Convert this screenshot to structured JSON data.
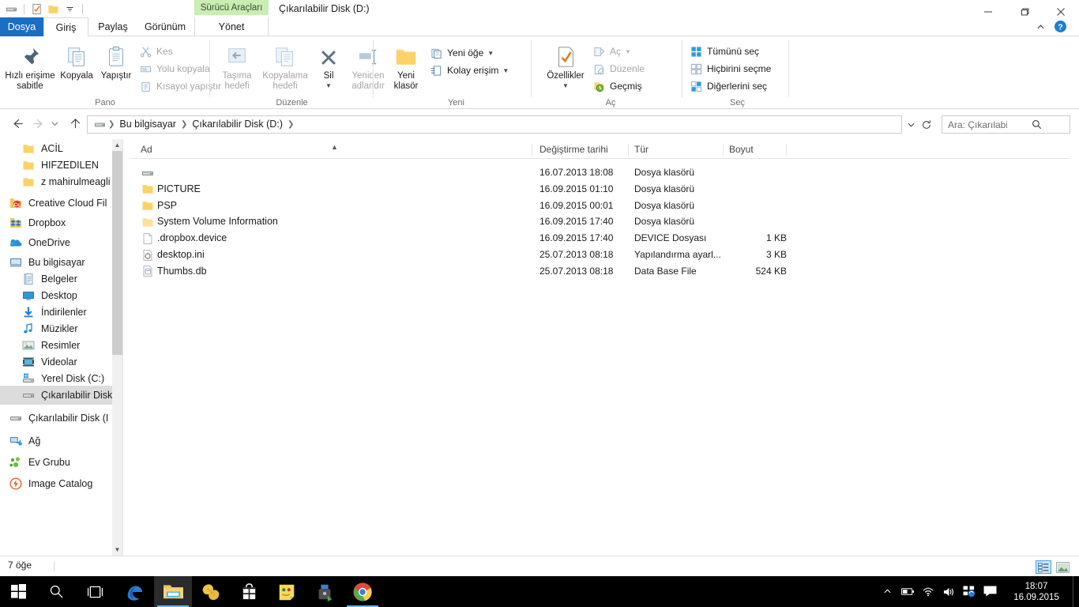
{
  "window": {
    "title": "Çıkarılabilir Disk (D:)",
    "contextual_tab": "Sürücü Araçları",
    "minimize": "minimize-button",
    "maximize": "maximize-button",
    "close": "close-button"
  },
  "quick_access": {
    "items": [
      "removable-drive-icon",
      "properties-icon",
      "new-folder-icon",
      "customize-dropdown-icon"
    ]
  },
  "tabs": [
    {
      "label": "Dosya",
      "kind": "file"
    },
    {
      "label": "Giriş",
      "kind": "active"
    },
    {
      "label": "Paylaş",
      "kind": "normal"
    },
    {
      "label": "Görünüm",
      "kind": "normal"
    },
    {
      "label": "Yönet",
      "kind": "manage"
    }
  ],
  "ribbon": {
    "collapse_label": "ribbon-collapse-icon",
    "help_label": "help-icon",
    "groups": [
      {
        "name": "Pano",
        "big": [
          {
            "label": "Hızlı erişime sabitle",
            "icon": "pin-icon"
          },
          {
            "label": "Kopyala",
            "icon": "copy-icon"
          },
          {
            "label": "Yapıştır",
            "icon": "paste-icon"
          }
        ],
        "small": [
          {
            "label": "Kes",
            "icon": "scissors-icon",
            "disabled": true
          },
          {
            "label": "Yolu kopyala",
            "icon": "copy-path-icon",
            "disabled": true
          },
          {
            "label": "Kısayol yapıştır",
            "icon": "paste-shortcut-icon",
            "disabled": true
          }
        ]
      },
      {
        "name": "Düzenle",
        "big": [
          {
            "label": "Taşıma hedefi",
            "icon": "move-to-icon",
            "dropdown": true,
            "disabled": true
          },
          {
            "label": "Kopyalama hedefi",
            "icon": "copy-to-icon",
            "dropdown": true,
            "disabled": true
          },
          {
            "label": "Sil",
            "icon": "delete-icon",
            "dropdown": true
          },
          {
            "label": "Yeniden adlandır",
            "icon": "rename-icon",
            "disabled": true
          }
        ]
      },
      {
        "name": "Yeni",
        "big": [
          {
            "label": "Yeni klasör",
            "icon": "new-folder-icon"
          }
        ],
        "small": [
          {
            "label": "Yeni öğe",
            "icon": "new-item-icon",
            "dropdown": true
          },
          {
            "label": "Kolay erişim",
            "icon": "easy-access-icon",
            "dropdown": true
          }
        ]
      },
      {
        "name": "Aç",
        "big": [
          {
            "label": "Özellikler",
            "icon": "properties-icon",
            "dropdown": true
          }
        ],
        "small": [
          {
            "label": "Aç",
            "icon": "open-icon",
            "dropdown": true,
            "disabled": true
          },
          {
            "label": "Düzenle",
            "icon": "edit-icon",
            "disabled": true
          },
          {
            "label": "Geçmiş",
            "icon": "history-icon"
          }
        ]
      },
      {
        "name": "Seç",
        "small": [
          {
            "label": "Tümünü seç",
            "icon": "select-all-icon"
          },
          {
            "label": "Hiçbirini seçme",
            "icon": "select-none-icon"
          },
          {
            "label": "Diğerlerini seç",
            "icon": "invert-selection-icon"
          }
        ]
      }
    ]
  },
  "navigation": {
    "back": "back-icon",
    "forward": "forward-icon",
    "recent": "recent-locations-icon",
    "up": "up-icon",
    "breadcrumb": [
      "Bu bilgisayar",
      "Çıkarılabilir Disk (D:)"
    ],
    "breadcrumb_icon": "removable-drive-icon",
    "refresh": "refresh-icon",
    "dropdown": "address-dropdown-icon"
  },
  "search": {
    "placeholder": "Ara: Çıkarılabilir Disk (...",
    "value": "",
    "icon": "search-icon"
  },
  "sidebar": {
    "items": [
      {
        "label": "ACİL",
        "icon": "folder-icon",
        "indent": 2
      },
      {
        "label": "HIFZEDILEN",
        "icon": "folder-icon",
        "indent": 2
      },
      {
        "label": "z mahirulmeagli",
        "icon": "folder-icon",
        "indent": 2
      },
      {
        "label": "Creative Cloud Fil",
        "icon": "creative-cloud-icon",
        "indent": 1
      },
      {
        "label": "Dropbox",
        "icon": "dropbox-icon",
        "indent": 1
      },
      {
        "label": "OneDrive",
        "icon": "onedrive-icon",
        "indent": 1
      },
      {
        "label": "Bu bilgisayar",
        "icon": "computer-icon",
        "indent": 1
      },
      {
        "label": "Belgeler",
        "icon": "documents-icon",
        "indent": 2
      },
      {
        "label": "Desktop",
        "icon": "desktop-icon",
        "indent": 2
      },
      {
        "label": "İndirilenler",
        "icon": "downloads-icon",
        "indent": 2
      },
      {
        "label": "Müzikler",
        "icon": "music-icon",
        "indent": 2
      },
      {
        "label": "Resimler",
        "icon": "pictures-icon",
        "indent": 2
      },
      {
        "label": "Videolar",
        "icon": "videos-icon",
        "indent": 2
      },
      {
        "label": "Yerel Disk (C:)",
        "icon": "local-disk-icon",
        "indent": 2
      },
      {
        "label": "Çıkarılabilir Disk",
        "icon": "removable-drive-icon",
        "indent": 2,
        "selected": true
      },
      {
        "label": "Çıkarılabilir Disk (I",
        "icon": "removable-drive-icon",
        "indent": 1
      },
      {
        "label": "Ağ",
        "icon": "network-icon",
        "indent": 1
      },
      {
        "label": "Ev Grubu",
        "icon": "homegroup-icon",
        "indent": 1
      },
      {
        "label": "Image Catalog",
        "icon": "image-catalog-icon",
        "indent": 1
      }
    ],
    "scroll_up": "scroll-up-arrow",
    "scroll_down": "scroll-down-arrow"
  },
  "file_list": {
    "columns": [
      {
        "label": "Ad",
        "sorted": true
      },
      {
        "label": "Değiştirme tarihi"
      },
      {
        "label": "Tür"
      },
      {
        "label": "Boyut"
      }
    ],
    "rows": [
      {
        "name": "",
        "date": "16.07.2013 18:08",
        "type": "Dosya klasörü",
        "size": "",
        "icon": "removable-drive-icon"
      },
      {
        "name": "PICTURE",
        "date": "16.09.2015 01:10",
        "type": "Dosya klasörü",
        "size": "",
        "icon": "folder-icon"
      },
      {
        "name": "PSP",
        "date": "16.09.2015 00:01",
        "type": "Dosya klasörü",
        "size": "",
        "icon": "folder-icon"
      },
      {
        "name": "System Volume Information",
        "date": "16.09.2015 17:40",
        "type": "Dosya klasörü",
        "size": "",
        "icon": "folder-dim-icon"
      },
      {
        "name": ".dropbox.device",
        "date": "16.09.2015 17:40",
        "type": "DEVICE Dosyası",
        "size": "1 KB",
        "icon": "generic-file-icon"
      },
      {
        "name": "desktop.ini",
        "date": "25.07.2013 08:18",
        "type": "Yapılandırma ayarl...",
        "size": "3 KB",
        "icon": "ini-file-icon"
      },
      {
        "name": "Thumbs.db",
        "date": "25.07.2013 08:18",
        "type": "Data Base File",
        "size": "524 KB",
        "icon": "db-file-icon"
      }
    ]
  },
  "status": {
    "item_count": "7 öğe",
    "details_view": "details-view-icon",
    "large_icons_view": "large-icons-view-icon"
  },
  "taskbar": {
    "start": "start-icon",
    "search": "search-icon",
    "taskview": "task-view-icon",
    "apps": [
      {
        "name": "microsoft-edge-icon"
      },
      {
        "name": "file-explorer-icon",
        "running": true,
        "active": true
      },
      {
        "name": "peanut-app-icon"
      },
      {
        "name": "microsoft-store-icon"
      },
      {
        "name": "sticky-notes-icon"
      },
      {
        "name": "security-lock-icon"
      },
      {
        "name": "google-chrome-icon",
        "running": true
      }
    ],
    "tray": [
      "show-hidden-icons",
      "battery-icon",
      "wifi-icon",
      "volume-icon",
      "network-sync-icon",
      "action-center-icon"
    ],
    "clock_time": "18:07",
    "clock_date": "16.09.2015"
  },
  "colors": {
    "file_tab": "#1b6ec2",
    "contextual_tab": "#c9edb2",
    "selection": "#dcdcdc",
    "accent": "#0078d7"
  }
}
